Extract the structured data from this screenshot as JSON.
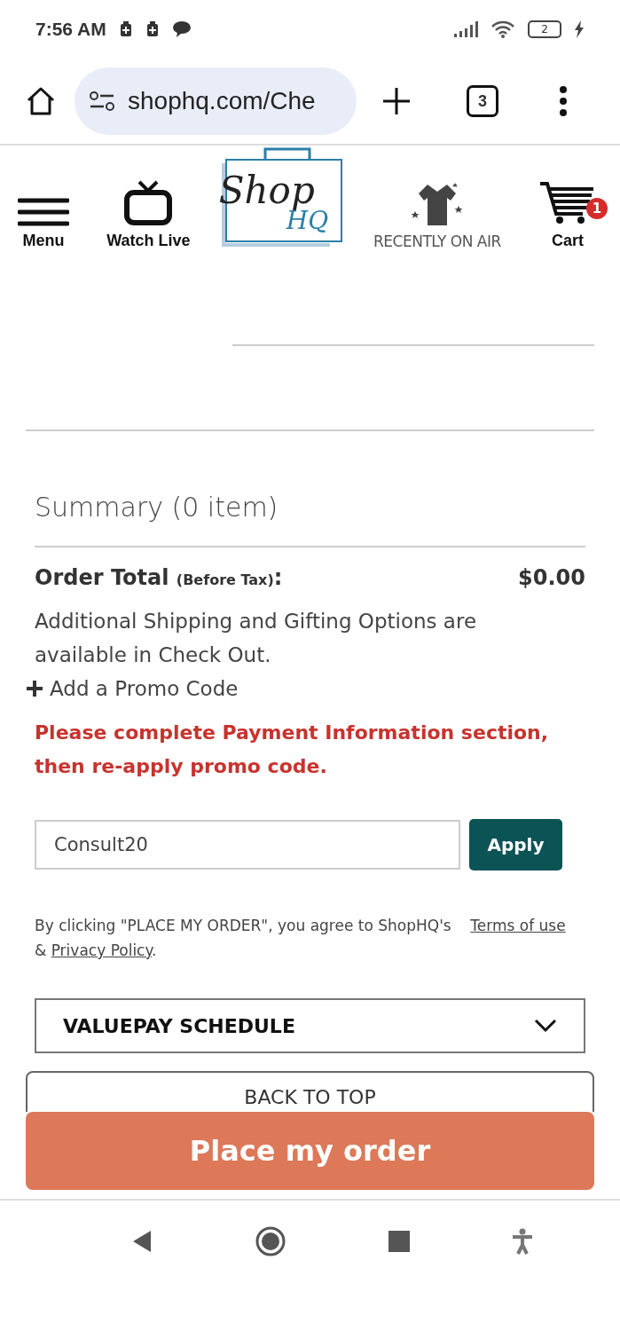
{
  "status_bar": {
    "time": "7:56 AM",
    "battery": "2"
  },
  "browser": {
    "url": "shophq.com/Che",
    "tab_count": "3"
  },
  "header": {
    "items": [
      {
        "kind": "menu",
        "label": "Menu"
      },
      {
        "kind": "tv",
        "label": "Watch Live"
      },
      {
        "kind": "logo",
        "label": "Shop",
        "sub": "HQ"
      },
      {
        "kind": "shirt",
        "label": "RECENTLY ON AIR"
      },
      {
        "kind": "cart",
        "label": "Cart",
        "badge": "1"
      }
    ]
  },
  "summary": {
    "title": "Summary (0 item)",
    "total_label": "Order Total",
    "total_note": "(Before Tax)",
    "total_colon": ":",
    "total_value": "$0.00",
    "info": "Additional Shipping and Gifting Options are available in Check Out.",
    "promo_toggle": "Add a Promo Code",
    "error": "Please complete Payment Information section, then re-apply promo code.",
    "promo_value": "Consult20",
    "apply": "Apply"
  },
  "terms": {
    "before": "By clicking \"PLACE MY ORDER\", you agree to ShopHQ's",
    "link1": "Terms of use",
    "amp": "&",
    "link2": "Privacy Policy",
    "end": "."
  },
  "valuepay": {
    "label": "VALUEPAY SCHEDULE",
    "expanded": false
  },
  "back_to_top": "BACK TO TOP",
  "place_order": "Place my order"
}
